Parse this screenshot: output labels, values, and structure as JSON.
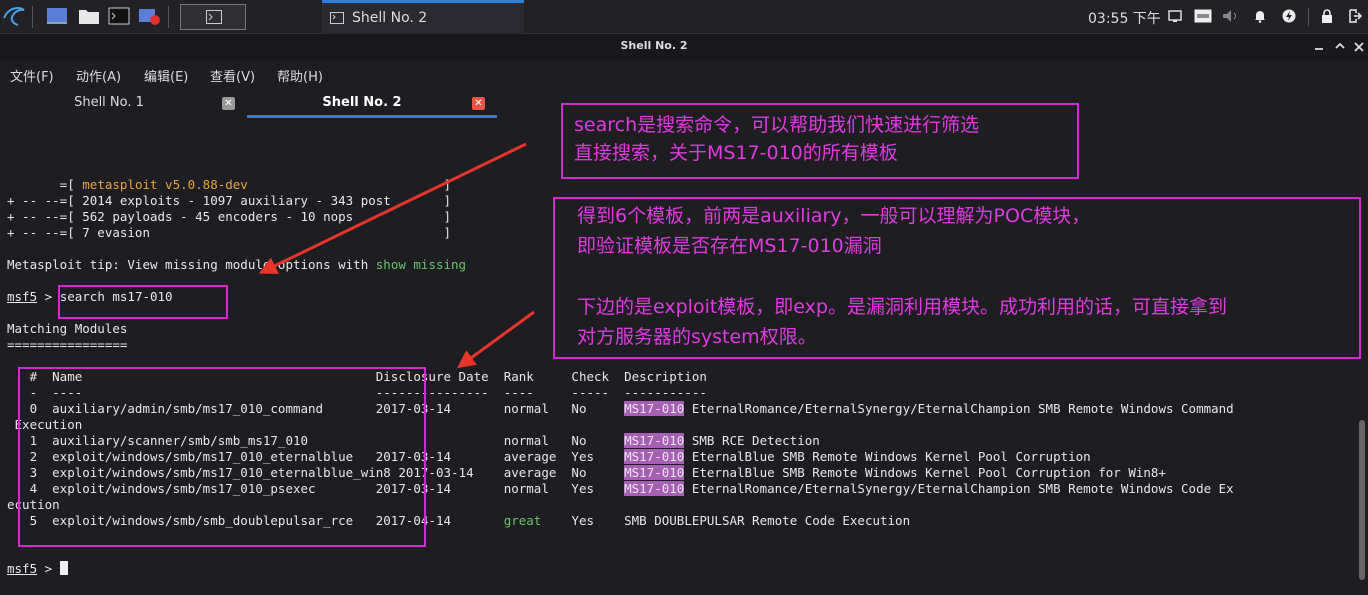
{
  "taskbar": {
    "window_title": "Shell No. 2",
    "clock": "03:55 下午"
  },
  "window": {
    "title": "Shell No. 2"
  },
  "menu": {
    "file": "文件(F)",
    "action": "动作(A)",
    "edit": "编辑(E)",
    "view": "查看(V)",
    "help": "帮助(H)"
  },
  "tabs": {
    "tab1": "Shell No. 1",
    "tab2": "Shell No. 2"
  },
  "terminal": {
    "banner": {
      "l1_prefix": "       =[ ",
      "l1_version": "metasploit v5.0.88-dev",
      "l1_suffix": "                          ]",
      "l2": "+ -- --=[ 2014 exploits - 1097 auxiliary - 343 post       ]",
      "l3": "+ -- --=[ 562 payloads - 45 encoders - 10 nops            ]",
      "l4": "+ -- --=[ 7 evasion                                       ]"
    },
    "tip_text": "Metasploit tip: View missing module options with ",
    "tip_cmd": "show missing",
    "prompt": "msf5",
    "prompt_sep": " > ",
    "command": "search ms17-010",
    "matching_title": "Matching Modules",
    "matching_underline": "================",
    "header": "   #  Name                                       Disclosure Date  Rank     Check  Description",
    "header_rule": "   -  ----                                       ---------------  ----     -----  -----------",
    "rows": [
      {
        "pre": "   0  auxiliary/admin/smb/ms17_010_command       2017-03-14       normal   No     ",
        "hl": "MS17-010",
        "post": " EternalRomance/EternalSynergy/EternalChampion SMB Remote Windows Command"
      },
      {
        "pre": " Execution",
        "hl": "",
        "post": ""
      },
      {
        "pre": "   1  auxiliary/scanner/smb/smb_ms17_010                          normal   No     ",
        "hl": "MS17-010",
        "post": " SMB RCE Detection"
      },
      {
        "pre": "   2  exploit/windows/smb/ms17_010_eternalblue   2017-03-14       average  Yes    ",
        "hl": "MS17-010",
        "post": " EternalBlue SMB Remote Windows Kernel Pool Corruption"
      },
      {
        "pre": "   3  exploit/windows/smb/ms17_010_eternalblue_win8 2017-03-14    average  No     ",
        "hl": "MS17-010",
        "post": " EternalBlue SMB Remote Windows Kernel Pool Corruption for Win8+"
      },
      {
        "pre": "   4  exploit/windows/smb/ms17_010_psexec        2017-03-14       normal   Yes    ",
        "hl": "MS17-010",
        "post": " EternalRomance/EternalSynergy/EternalChampion SMB Remote Windows Code Ex"
      },
      {
        "pre": "ecution",
        "hl": "",
        "post": ""
      }
    ],
    "row5_a": "   5  exploit/windows/smb/smb_doublepulsar_rce   2017-04-14       ",
    "row5_rank": "great",
    "row5_b": "    Yes    SMB DOUBLEPULSAR Remote Code Execution"
  },
  "annotations": {
    "a1_l1": "search是搜索命令，可以帮助我们快速进行筛选",
    "a1_l2": "直接搜索，关于MS17-010的所有模板",
    "a2_l1": "得到6个模板，前两是auxiliary，一般可以理解为POC模块，",
    "a2_l2": "即验证模板是否存在MS17-010漏洞",
    "a2_l3": "下边的是exploit模板，即exp。是漏洞利用模块。成功利用的话，可直接拿到",
    "a2_l4": "对方服务器的system权限。"
  },
  "colors": {
    "annotation": "#d428d4",
    "arrow": "#e8352a",
    "highlight": "#a65fb4",
    "tab_active_underline": "#2d7fd8"
  }
}
